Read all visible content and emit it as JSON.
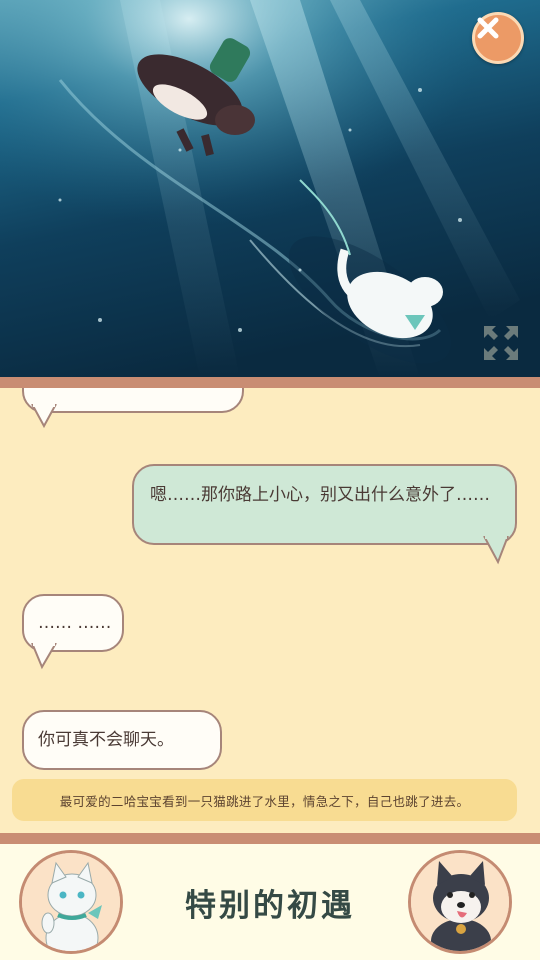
{
  "story": {
    "messages": [
      {
        "side": "left",
        "text": ""
      },
      {
        "side": "right",
        "text": "嗯……那你路上小心，别又出什么意外了……"
      },
      {
        "side": "left",
        "text": "…… ……"
      },
      {
        "side": "left",
        "text": "你可真不会聊天。"
      }
    ],
    "narration": "最可爱的二哈宝宝看到一只猫跳进了水里，情急之下，自己也跳了进去。",
    "chapter_title": "特别的初遇"
  },
  "colors": {
    "background": "#fdecbf",
    "divider": "#c98d73",
    "bubble_left": "#fffdf7",
    "bubble_right": "#cfe8d6",
    "bubble_border": "#a6857a",
    "narration_bg": "#f8dc92",
    "close_button": "#ec9a66",
    "title": "#354a45"
  },
  "icons": {
    "close": "close-icon",
    "expand": "expand-icon"
  }
}
